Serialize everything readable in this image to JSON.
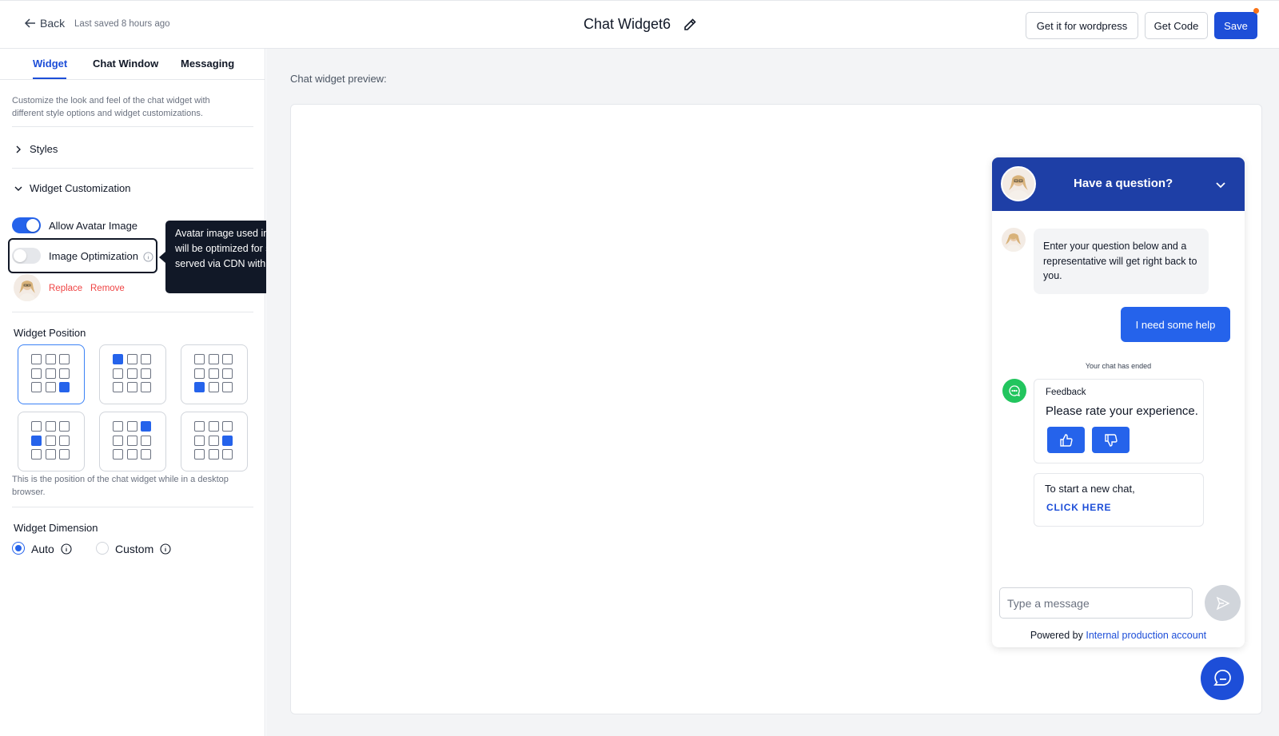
{
  "header": {
    "back_label": "Back",
    "last_saved": "Last saved 8 hours ago",
    "title": "Chat Widget6",
    "wordpress_button": "Get it for wordpress",
    "get_code_button": "Get Code",
    "save_button": "Save"
  },
  "sidebar": {
    "tabs": [
      {
        "label": "Widget",
        "active": true
      },
      {
        "label": "Chat Window",
        "active": false
      },
      {
        "label": "Messaging",
        "active": false
      }
    ],
    "description": "Customize the look and feel of the chat widget with different style options and widget customizations.",
    "styles_section": "Styles",
    "customization_section": "Widget Customization",
    "allow_avatar_label": "Allow Avatar Image",
    "allow_avatar_on": true,
    "image_optimization_label": "Image Optimization",
    "image_optimization_on": false,
    "replace_label": "Replace",
    "remove_label": "Remove",
    "tooltip": "Avatar image used in this chat widget will be optimized for speed and served via CDN with caching enabled",
    "position_label": "Widget Position",
    "position_hint": "This is the position of the chat widget while in a desktop browser.",
    "positions": [
      {
        "name": "bottom-right",
        "selected": true
      },
      {
        "name": "top-left",
        "selected": false
      },
      {
        "name": "bottom-left",
        "selected": false
      },
      {
        "name": "middle-left",
        "selected": false
      },
      {
        "name": "top-right",
        "selected": false
      },
      {
        "name": "middle-right",
        "selected": false
      }
    ],
    "dimension_label": "Widget Dimension",
    "dimension_options": [
      {
        "label": "Auto",
        "checked": true
      },
      {
        "label": "Custom",
        "checked": false
      }
    ]
  },
  "main": {
    "preview_label": "Chat widget preview:"
  },
  "chat": {
    "title": "Have a question?",
    "greeting": "Enter your question below and a representative will get right back to you.",
    "user_message": "I need some help",
    "ended_text": "Your chat has ended",
    "feedback_title": "Feedback",
    "feedback_prompt": "Please rate your experience.",
    "new_chat_text": "To start a new chat,",
    "new_chat_link": "CLICK HERE",
    "input_placeholder": "Type a message",
    "powered_by": "Powered by",
    "powered_link": "Internal production account"
  },
  "colors": {
    "accent": "#1d4ed8",
    "header_bg": "#1e3fa6",
    "danger": "#ef4444",
    "success": "#22c55e"
  }
}
